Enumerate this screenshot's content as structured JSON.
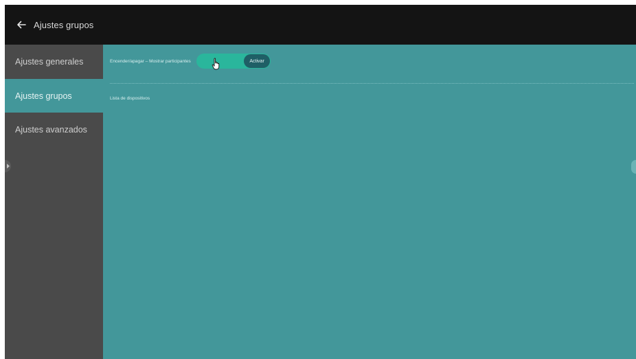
{
  "header": {
    "title": "Ajustes grupos",
    "back_icon": "arrow-left-icon"
  },
  "sidebar": {
    "items": [
      {
        "label": "Ajustes generales",
        "active": false
      },
      {
        "label": "Ajustes grupos",
        "active": true
      },
      {
        "label": "Ajustes avanzados",
        "active": false
      }
    ],
    "expand_icon": "chevron-right-icon"
  },
  "main": {
    "toggle_row": {
      "label": "Encender/apagar – Mostrar participantes",
      "toggle_state_label": "Activar",
      "state": "on"
    },
    "section_title": "Lista de dispositivos"
  },
  "colors": {
    "topbar": "#141414",
    "sidebar": "#4a4a4a",
    "accent": "#43979a",
    "toggle_track": "#2ab69c",
    "toggle_knob": "#1f5f66"
  }
}
